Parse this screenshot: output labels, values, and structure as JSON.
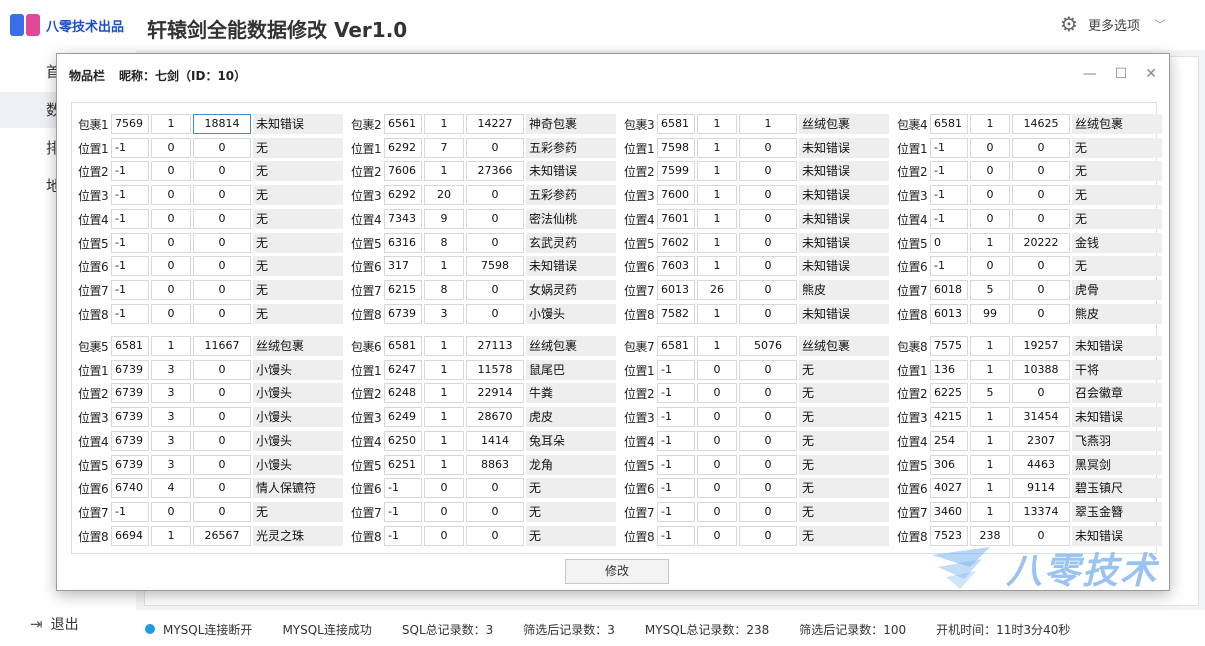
{
  "app": {
    "brand": "八零技术出品",
    "title": "轩辕剑全能数据修改  Ver1.0",
    "more_options": "更多选项",
    "logout": "退出"
  },
  "sidebar": {
    "items": [
      {
        "label": "首"
      },
      {
        "label": "数"
      },
      {
        "label": "排"
      },
      {
        "label": "地"
      }
    ]
  },
  "dialog": {
    "title": "物品栏",
    "nickname": "昵称：七剑（ID：10）",
    "modify_button": "修改",
    "bags": [
      {
        "rows": [
          [
            "包裹1",
            "7569",
            "1",
            "18814",
            "未知错误"
          ],
          [
            "位置1",
            "-1",
            "0",
            "0",
            "无"
          ],
          [
            "位置2",
            "-1",
            "0",
            "0",
            "无"
          ],
          [
            "位置3",
            "-1",
            "0",
            "0",
            "无"
          ],
          [
            "位置4",
            "-1",
            "0",
            "0",
            "无"
          ],
          [
            "位置5",
            "-1",
            "0",
            "0",
            "无"
          ],
          [
            "位置6",
            "-1",
            "0",
            "0",
            "无"
          ],
          [
            "位置7",
            "-1",
            "0",
            "0",
            "无"
          ],
          [
            "位置8",
            "-1",
            "0",
            "0",
            "无"
          ]
        ]
      },
      {
        "rows": [
          [
            "包裹2",
            "6561",
            "1",
            "14227",
            "神奇包裹"
          ],
          [
            "位置1",
            "6292",
            "7",
            "0",
            "五彩参药"
          ],
          [
            "位置2",
            "7606",
            "1",
            "27366",
            "未知错误"
          ],
          [
            "位置3",
            "6292",
            "20",
            "0",
            "五彩参药"
          ],
          [
            "位置4",
            "7343",
            "9",
            "0",
            "密法仙桃"
          ],
          [
            "位置5",
            "6316",
            "8",
            "0",
            "玄武灵药"
          ],
          [
            "位置6",
            "317",
            "1",
            "7598",
            "未知错误"
          ],
          [
            "位置7",
            "6215",
            "8",
            "0",
            "女娲灵药"
          ],
          [
            "位置8",
            "6739",
            "3",
            "0",
            "小馒头"
          ]
        ]
      },
      {
        "rows": [
          [
            "包裹3",
            "6581",
            "1",
            "1",
            "丝绒包裹"
          ],
          [
            "位置1",
            "7598",
            "1",
            "0",
            "未知错误"
          ],
          [
            "位置2",
            "7599",
            "1",
            "0",
            "未知错误"
          ],
          [
            "位置3",
            "7600",
            "1",
            "0",
            "未知错误"
          ],
          [
            "位置4",
            "7601",
            "1",
            "0",
            "未知错误"
          ],
          [
            "位置5",
            "7602",
            "1",
            "0",
            "未知错误"
          ],
          [
            "位置6",
            "7603",
            "1",
            "0",
            "未知错误"
          ],
          [
            "位置7",
            "6013",
            "26",
            "0",
            "熊皮"
          ],
          [
            "位置8",
            "7582",
            "1",
            "0",
            "未知错误"
          ]
        ]
      },
      {
        "rows": [
          [
            "包裹4",
            "6581",
            "1",
            "14625",
            "丝绒包裹"
          ],
          [
            "位置1",
            "-1",
            "0",
            "0",
            "无"
          ],
          [
            "位置2",
            "-1",
            "0",
            "0",
            "无"
          ],
          [
            "位置3",
            "-1",
            "0",
            "0",
            "无"
          ],
          [
            "位置4",
            "-1",
            "0",
            "0",
            "无"
          ],
          [
            "位置5",
            "0",
            "1",
            "20222",
            "金钱"
          ],
          [
            "位置6",
            "-1",
            "0",
            "0",
            "无"
          ],
          [
            "位置7",
            "6018",
            "5",
            "0",
            "虎骨"
          ],
          [
            "位置8",
            "6013",
            "99",
            "0",
            "熊皮"
          ]
        ]
      },
      {
        "rows": [
          [
            "包裹5",
            "6581",
            "1",
            "11667",
            "丝绒包裹"
          ],
          [
            "位置1",
            "6739",
            "3",
            "0",
            "小馒头"
          ],
          [
            "位置2",
            "6739",
            "3",
            "0",
            "小馒头"
          ],
          [
            "位置3",
            "6739",
            "3",
            "0",
            "小馒头"
          ],
          [
            "位置4",
            "6739",
            "3",
            "0",
            "小馒头"
          ],
          [
            "位置5",
            "6739",
            "3",
            "0",
            "小馒头"
          ],
          [
            "位置6",
            "6740",
            "4",
            "0",
            "情人保镳符"
          ],
          [
            "位置7",
            "-1",
            "0",
            "0",
            "无"
          ],
          [
            "位置8",
            "6694",
            "1",
            "26567",
            "光灵之珠"
          ]
        ]
      },
      {
        "rows": [
          [
            "包裹6",
            "6581",
            "1",
            "27113",
            "丝绒包裹"
          ],
          [
            "位置1",
            "6247",
            "1",
            "11578",
            "鼠尾巴"
          ],
          [
            "位置2",
            "6248",
            "1",
            "22914",
            "牛粪"
          ],
          [
            "位置3",
            "6249",
            "1",
            "28670",
            "虎皮"
          ],
          [
            "位置4",
            "6250",
            "1",
            "1414",
            "兔耳朵"
          ],
          [
            "位置5",
            "6251",
            "1",
            "8863",
            "龙角"
          ],
          [
            "位置6",
            "-1",
            "0",
            "0",
            "无"
          ],
          [
            "位置7",
            "-1",
            "0",
            "0",
            "无"
          ],
          [
            "位置8",
            "-1",
            "0",
            "0",
            "无"
          ]
        ]
      },
      {
        "rows": [
          [
            "包裹7",
            "6581",
            "1",
            "5076",
            "丝绒包裹"
          ],
          [
            "位置1",
            "-1",
            "0",
            "0",
            "无"
          ],
          [
            "位置2",
            "-1",
            "0",
            "0",
            "无"
          ],
          [
            "位置3",
            "-1",
            "0",
            "0",
            "无"
          ],
          [
            "位置4",
            "-1",
            "0",
            "0",
            "无"
          ],
          [
            "位置5",
            "-1",
            "0",
            "0",
            "无"
          ],
          [
            "位置6",
            "-1",
            "0",
            "0",
            "无"
          ],
          [
            "位置7",
            "-1",
            "0",
            "0",
            "无"
          ],
          [
            "位置8",
            "-1",
            "0",
            "0",
            "无"
          ]
        ]
      },
      {
        "rows": [
          [
            "包裹8",
            "7575",
            "1",
            "19257",
            "未知错误"
          ],
          [
            "位置1",
            "136",
            "1",
            "10388",
            "干将"
          ],
          [
            "位置2",
            "6225",
            "5",
            "0",
            "召会徽章"
          ],
          [
            "位置3",
            "4215",
            "1",
            "31454",
            "未知错误"
          ],
          [
            "位置4",
            "254",
            "1",
            "2307",
            "飞燕羽"
          ],
          [
            "位置5",
            "306",
            "1",
            "4463",
            "黑冥剑"
          ],
          [
            "位置6",
            "4027",
            "1",
            "9114",
            "碧玉镇尺"
          ],
          [
            "位置7",
            "3460",
            "1",
            "13374",
            "翠玉金簪"
          ],
          [
            "位置8",
            "7523",
            "238",
            "0",
            "未知错误"
          ]
        ]
      }
    ]
  },
  "status": {
    "disconnected": "MYSQL连接断开",
    "connected": "MYSQL连接成功",
    "sql_total": "SQL总记录数：3",
    "sql_filtered": "筛选后记录数：3",
    "mysql_total": "MYSQL总记录数：238",
    "mysql_filtered": "筛选后记录数：100",
    "uptime": "开机时间：11时3分40秒",
    "dot_color": "#1f9bde"
  },
  "watermark": {
    "text": "八零技术"
  }
}
